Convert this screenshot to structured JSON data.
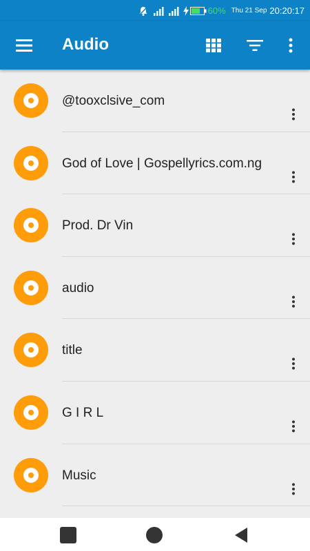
{
  "status_bar": {
    "battery_percent": "60%",
    "date": "Thu 21 Sep",
    "time": "20:20:17",
    "colors": {
      "background": "#0d82c6",
      "battery": "#4cd964"
    }
  },
  "app_bar": {
    "title": "Audio",
    "colors": {
      "background": "#0d82c6",
      "text": "#ffffff"
    },
    "icons": [
      "menu-icon",
      "grid-view-icon",
      "filter-icon",
      "more-vert-icon"
    ]
  },
  "audio_list": {
    "items": [
      {
        "title": "@tooxclsive_com"
      },
      {
        "title": "God of Love | Gospellyrics.com.ng"
      },
      {
        "title": "Prod. Dr Vin"
      },
      {
        "title": "audio"
      },
      {
        "title": "title"
      },
      {
        "title": "G I R L"
      },
      {
        "title": "Music"
      }
    ],
    "icon": "disc-icon",
    "colors": {
      "disc": "#ff9c0a",
      "background": "#eeeeee",
      "text": "#222222"
    }
  },
  "nav_bar": {
    "icons": [
      "recents-icon",
      "home-icon",
      "back-icon"
    ]
  }
}
